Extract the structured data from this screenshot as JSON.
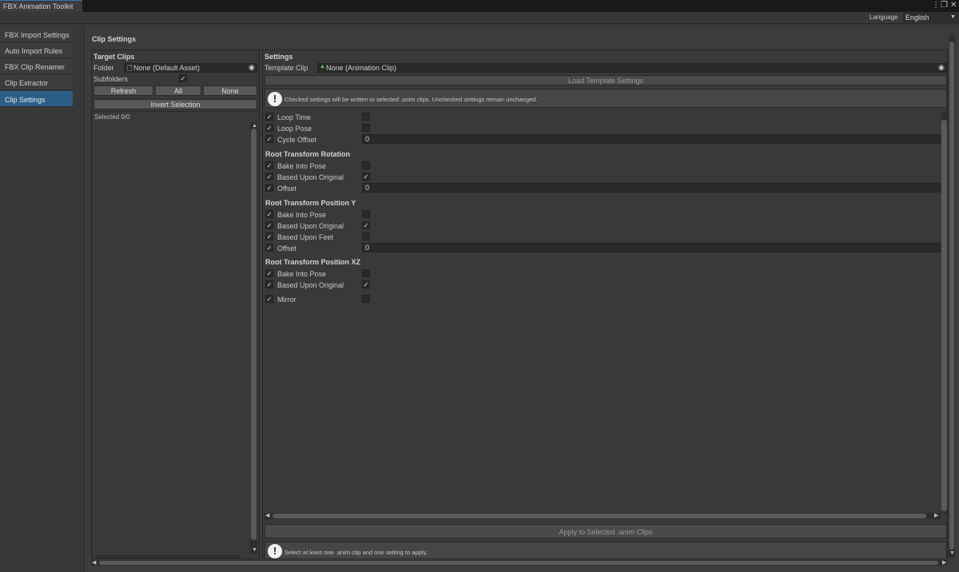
{
  "window": {
    "tab_title": "FBX Animation Toolkit",
    "icons": [
      "kebab-menu-icon",
      "maximize-icon",
      "close-icon"
    ]
  },
  "language": {
    "label": "Language",
    "selected": "English"
  },
  "sidebar": {
    "items": [
      {
        "label": "FBX Import Settings"
      },
      {
        "label": "Auto Import Rules"
      },
      {
        "label": "FBX Clip Renamer"
      },
      {
        "label": "Clip Extractor"
      },
      {
        "label": "Clip Settings",
        "active": true
      }
    ]
  },
  "page": {
    "title": "Clip Settings"
  },
  "target_clips": {
    "header": "Target Clips",
    "folder_label": "Folder",
    "folder_value": "None (Default Asset)",
    "subfolders_label": "Subfolders",
    "subfolders_checked": true,
    "refresh_label": "Refresh",
    "all_label": "All",
    "none_label": "None",
    "invert_label": "Invert Selection",
    "selected_count": "Selected 0/0"
  },
  "settings": {
    "header": "Settings",
    "template_label": "Template Clip",
    "template_value": "None (Animation Clip)",
    "load_template_label": "Load Template Settings",
    "info_top": "Checked settings will be written to selected .anim clips. Unchecked settings remain unchanged.",
    "rows": {
      "loop_time": {
        "label": "Loop Time",
        "enabled": true,
        "value": false
      },
      "loop_pose": {
        "label": "Loop Pose",
        "enabled": true,
        "value": false
      },
      "cycle_offset": {
        "label": "Cycle Offset",
        "enabled": true,
        "value": "0"
      }
    },
    "rotation": {
      "header": "Root Transform Rotation",
      "bake_into_pose": {
        "label": "Bake Into Pose",
        "enabled": true,
        "value": false
      },
      "based_upon_original": {
        "label": "Based Upon Original",
        "enabled": true,
        "value": true
      },
      "offset": {
        "label": "Offset",
        "enabled": true,
        "value": "0"
      }
    },
    "position_y": {
      "header": "Root Transform Position Y",
      "bake_into_pose": {
        "label": "Bake Into Pose",
        "enabled": true,
        "value": false
      },
      "based_upon_original": {
        "label": "Based Upon Original",
        "enabled": true,
        "value": true
      },
      "based_upon_feet": {
        "label": "Based Upon Feet",
        "enabled": true,
        "value": false
      },
      "offset": {
        "label": "Offset",
        "enabled": true,
        "value": "0"
      }
    },
    "position_xz": {
      "header": "Root Transform Position XZ",
      "bake_into_pose": {
        "label": "Bake Into Pose",
        "enabled": true,
        "value": false
      },
      "based_upon_original": {
        "label": "Based Upon Original",
        "enabled": true,
        "value": true
      }
    },
    "mirror": {
      "label": "Mirror",
      "enabled": true,
      "value": false
    },
    "apply_label": "Apply to Selected .anim Clips",
    "info_bottom": "Select at least one .anim clip and one setting to apply."
  },
  "glyphs": {
    "check": "✓",
    "info": "!"
  }
}
